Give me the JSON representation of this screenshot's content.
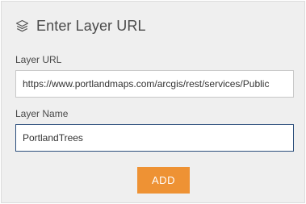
{
  "dialog": {
    "title": "Enter Layer URL",
    "icon": "layers-icon"
  },
  "layer_url": {
    "label": "Layer URL",
    "value": "https://www.portlandmaps.com/arcgis/rest/services/Public"
  },
  "layer_name": {
    "label": "Layer Name",
    "value": "PortlandTrees"
  },
  "actions": {
    "add_label": "ADD"
  },
  "colors": {
    "accent": "#ee9234",
    "panel_bg": "#efefef",
    "focus_border": "#2c4f7c",
    "text": "#4a4a4a"
  }
}
